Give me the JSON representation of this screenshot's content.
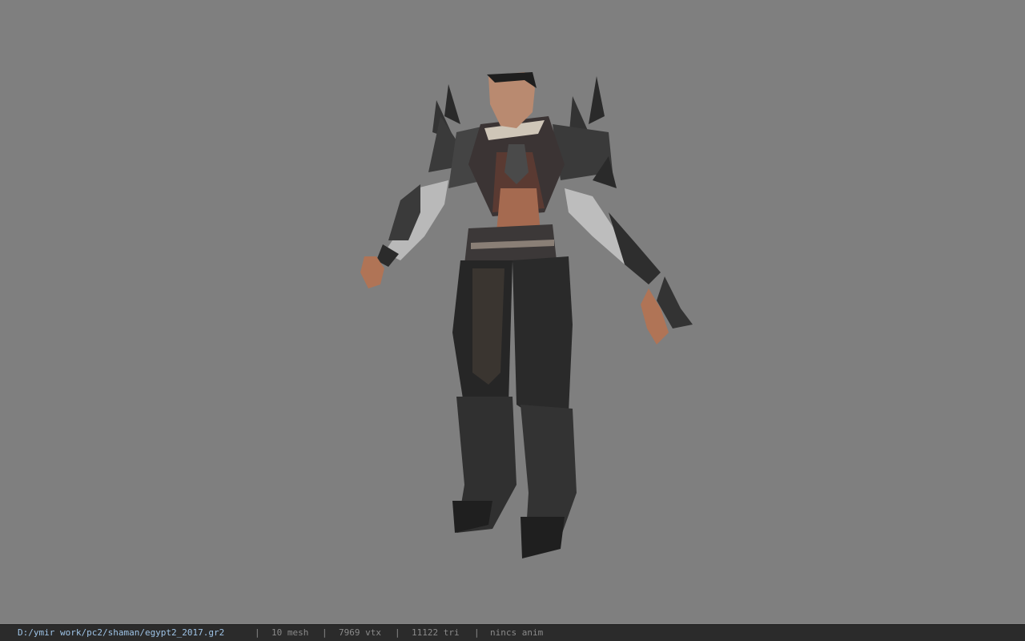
{
  "viewport": {
    "background_color": "#7f7f7f",
    "model": {
      "icon": "character-model",
      "description_visible": false
    }
  },
  "statusbar": {
    "file_path": "D:/ymir work/pc2/shaman/egypt2_2017.gr2",
    "separator": "|",
    "mesh_count": "10 mesh",
    "vertex_count": "7969 vtx",
    "triangle_count": "11122 tri",
    "anim_status": "nincs anim",
    "path_color": "#9ec3e6",
    "text_color": "#8a8a8a",
    "background_color": "#2b2b2b"
  }
}
